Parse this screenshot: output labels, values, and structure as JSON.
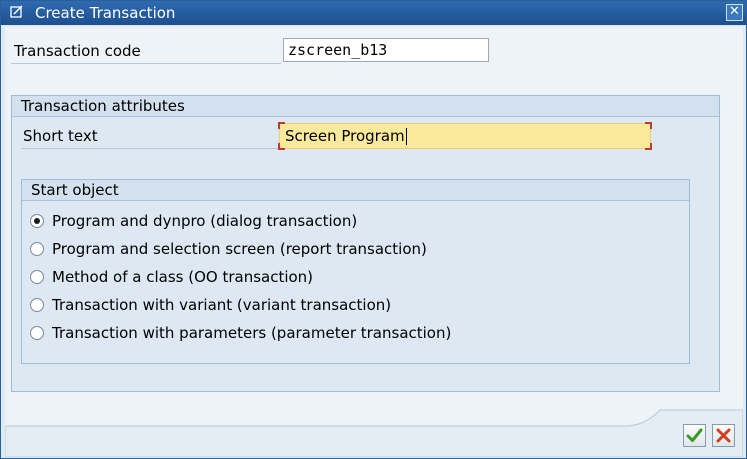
{
  "window": {
    "title": "Create Transaction",
    "title_icon": "create-transaction-icon",
    "close_icon": "close-icon",
    "close_glyph": "✕"
  },
  "transaction_code": {
    "label": "Transaction code",
    "value": "zscreen_b13"
  },
  "attributes": {
    "title": "Transaction attributes",
    "short_text_label": "Short text",
    "short_text_value": "Screen Program"
  },
  "start_object": {
    "title": "Start object",
    "options": [
      {
        "label": "Program and dynpro (dialog transaction)",
        "selected": true
      },
      {
        "label": "Program and selection screen (report transaction)",
        "selected": false
      },
      {
        "label": "Method of a class (OO transaction)",
        "selected": false
      },
      {
        "label": "Transaction with variant (variant transaction)",
        "selected": false
      },
      {
        "label": "Transaction with parameters (parameter transaction)",
        "selected": false
      }
    ]
  },
  "footer": {
    "confirm_icon": "checkmark-icon",
    "cancel_icon": "cancel-x-icon",
    "colors": {
      "confirm": "#3a9a1f",
      "cancel": "#d0401a"
    }
  }
}
